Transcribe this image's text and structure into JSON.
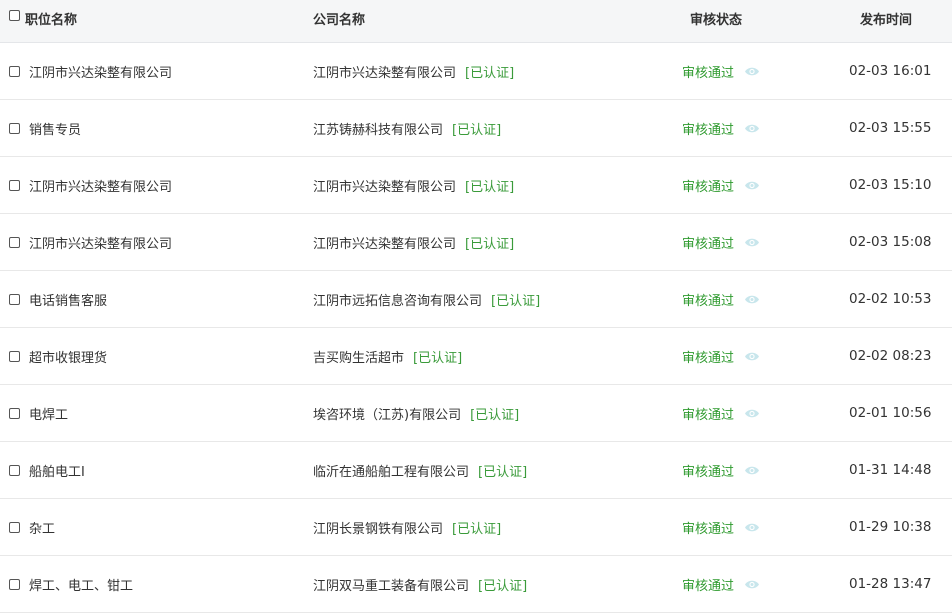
{
  "colors": {
    "header_bg": "#f5f6f7",
    "status_green": "#2e9a2e",
    "verified_green": "#3a9b3a",
    "eye_icon": "#b9dfe6"
  },
  "header": {
    "title": "职位名称",
    "company": "公司名称",
    "status": "审核状态",
    "time": "发布时间"
  },
  "rows": [
    {
      "title": "江阴市兴达染整有限公司",
      "company": "江阴市兴达染整有限公司",
      "verified": "[已认证]",
      "status": "审核通过",
      "time": "02-03 16:01"
    },
    {
      "title": "销售专员",
      "company": "江苏铸赫科技有限公司",
      "verified": "[已认证]",
      "status": "审核通过",
      "time": "02-03 15:55"
    },
    {
      "title": "江阴市兴达染整有限公司",
      "company": "江阴市兴达染整有限公司",
      "verified": "[已认证]",
      "status": "审核通过",
      "time": "02-03 15:10"
    },
    {
      "title": "江阴市兴达染整有限公司",
      "company": "江阴市兴达染整有限公司",
      "verified": "[已认证]",
      "status": "审核通过",
      "time": "02-03 15:08"
    },
    {
      "title": "电话销售客服",
      "company": "江阴市远拓信息咨询有限公司",
      "verified": "[已认证]",
      "status": "审核通过",
      "time": "02-02 10:53"
    },
    {
      "title": "超市收银理货",
      "company": "吉买购生活超市",
      "verified": "[已认证]",
      "status": "审核通过",
      "time": "02-02 08:23"
    },
    {
      "title": "电焊工",
      "company": "埃咨环境（江苏)有限公司",
      "verified": "[已认证]",
      "status": "审核通过",
      "time": "02-01 10:56"
    },
    {
      "title": "船舶电工I",
      "company": "临沂在通船舶工程有限公司",
      "verified": "[已认证]",
      "status": "审核通过",
      "time": "01-31 14:48"
    },
    {
      "title": "杂工",
      "company": "江阴长景钢铁有限公司",
      "verified": "[已认证]",
      "status": "审核通过",
      "time": "01-29 10:38"
    },
    {
      "title": "焊工、电工、钳工",
      "company": "江阴双马重工装备有限公司",
      "verified": "[已认证]",
      "status": "审核通过",
      "time": "01-28 13:47"
    }
  ]
}
